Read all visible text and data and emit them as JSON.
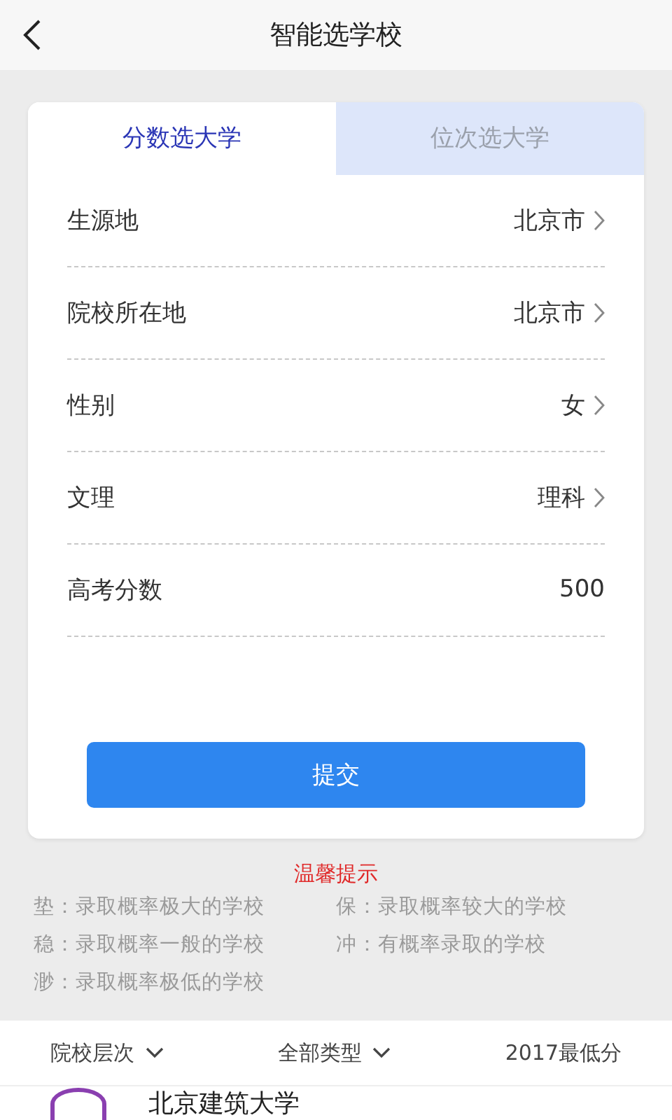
{
  "header": {
    "title": "智能选学校"
  },
  "tabs": [
    {
      "label": "分数选大学",
      "selected": true
    },
    {
      "label": "位次选大学",
      "selected": false
    }
  ],
  "fields": [
    {
      "kind": "select",
      "label": "生源地",
      "value": "北京市"
    },
    {
      "kind": "select",
      "label": "院校所在地",
      "value": "北京市"
    },
    {
      "kind": "select",
      "label": "性别",
      "value": "女"
    },
    {
      "kind": "select",
      "label": "文理",
      "value": "理科"
    },
    {
      "kind": "input",
      "label": "高考分数",
      "value": "500"
    }
  ],
  "submit": "提交",
  "tips": {
    "title": "温馨提示",
    "items": [
      "垫：录取概率极大的学校",
      "保：录取概率较大的学校",
      "稳：录取概率一般的学校",
      "冲：有概率录取的学校",
      "渺：录取概率极低的学校"
    ]
  },
  "filters": [
    {
      "kind": "dropdown",
      "label": "院校层次"
    },
    {
      "kind": "dropdown",
      "label": "全部类型"
    },
    {
      "kind": "text",
      "label": "2017最低分"
    }
  ],
  "schools": [
    {
      "name": "北京建筑大学",
      "color": "#8a3fb0"
    }
  ]
}
